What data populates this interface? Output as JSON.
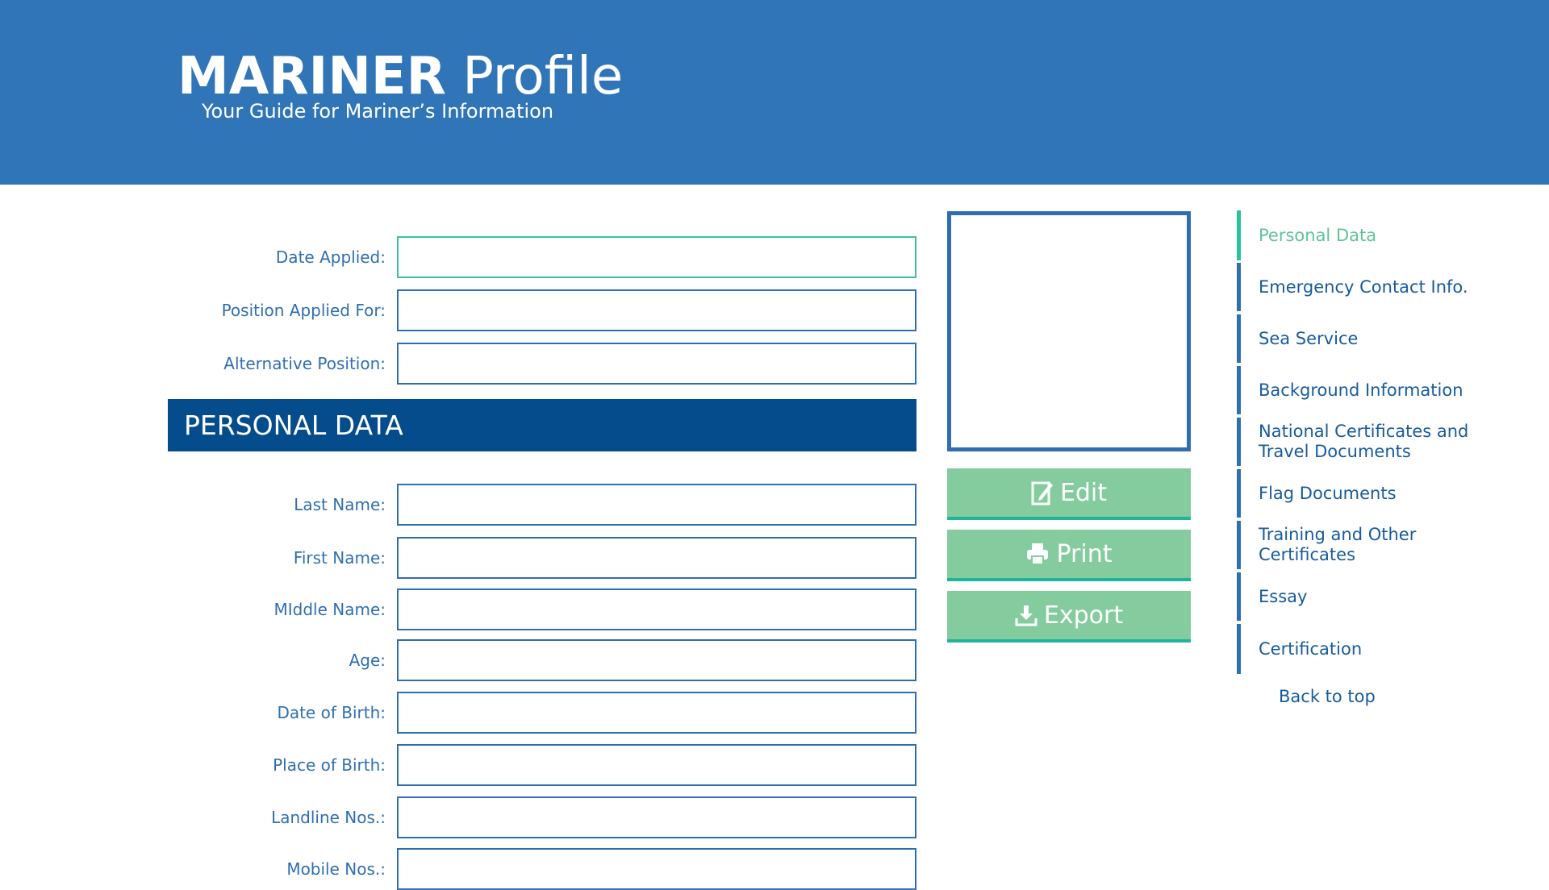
{
  "header": {
    "title_bold": "MARINER",
    "title_rest": " Profile",
    "subtitle": "Your Guide for Mariner’s Information"
  },
  "application_fields": [
    {
      "label": "Date Applied:",
      "value": ""
    },
    {
      "label": "Position Applied For:",
      "value": ""
    },
    {
      "label": "Alternative Position:",
      "value": ""
    }
  ],
  "section": {
    "title": "PERSONAL DATA"
  },
  "personal_fields": [
    {
      "label": "Last Name:",
      "value": ""
    },
    {
      "label": "First Name:",
      "value": ""
    },
    {
      "label": "MIddle Name:",
      "value": ""
    },
    {
      "label": "Age:",
      "value": ""
    },
    {
      "label": "Date of Birth:",
      "value": ""
    },
    {
      "label": "Place of Birth:",
      "value": ""
    },
    {
      "label": "Landline Nos.:",
      "value": ""
    },
    {
      "label": "Mobile Nos.:",
      "value": ""
    }
  ],
  "actions": {
    "edit": "Edit",
    "print": "Print",
    "export": "Export"
  },
  "nav": {
    "items": [
      {
        "label": "Personal Data"
      },
      {
        "label": "Emergency Contact Info."
      },
      {
        "label": "Sea Service"
      },
      {
        "label": "Background Information"
      },
      {
        "label": "National Certificates and Travel Documents"
      },
      {
        "label": "Flag Documents"
      },
      {
        "label": "Training and Other Certificates"
      },
      {
        "label": "Essay"
      },
      {
        "label": "Certification"
      }
    ],
    "back_to_top": "Back to top"
  },
  "colors": {
    "header_bg": "#3075b8",
    "section_bg": "#054c8c",
    "button_bg": "#84cc9e",
    "active_accent": "#28c39c",
    "label_text": "#2f6fb0"
  },
  "icons": {
    "edit": "edit-icon",
    "print": "printer-icon",
    "export": "download-icon"
  }
}
